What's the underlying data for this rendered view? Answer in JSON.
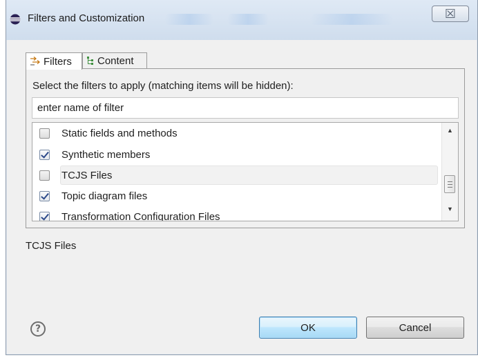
{
  "window": {
    "title": "Filters and Customization",
    "close_glyph": "☒"
  },
  "tabs": [
    {
      "label": "Filters",
      "icon": "filter-arrows-icon",
      "active": true
    },
    {
      "label": "Content",
      "icon": "content-tree-icon",
      "active": false
    }
  ],
  "filters": {
    "instructions": "Select the filters to apply (matching items will be hidden):",
    "search_value": "enter name of filter",
    "items": [
      {
        "label": "Static fields and methods",
        "checked": false
      },
      {
        "label": "Synthetic members",
        "checked": true
      },
      {
        "label": "TCJS Files",
        "checked": false
      },
      {
        "label": "Topic diagram files",
        "checked": true
      },
      {
        "label": "Transformation Configuration Files",
        "checked": true
      }
    ]
  },
  "description": "TCJS Files",
  "footer": {
    "help_glyph": "?",
    "ok_label": "OK",
    "cancel_label": "Cancel"
  },
  "colors": {
    "titlebar": "#cfdded",
    "default_button": "#bee6fd",
    "check": "#2c4a8a"
  }
}
